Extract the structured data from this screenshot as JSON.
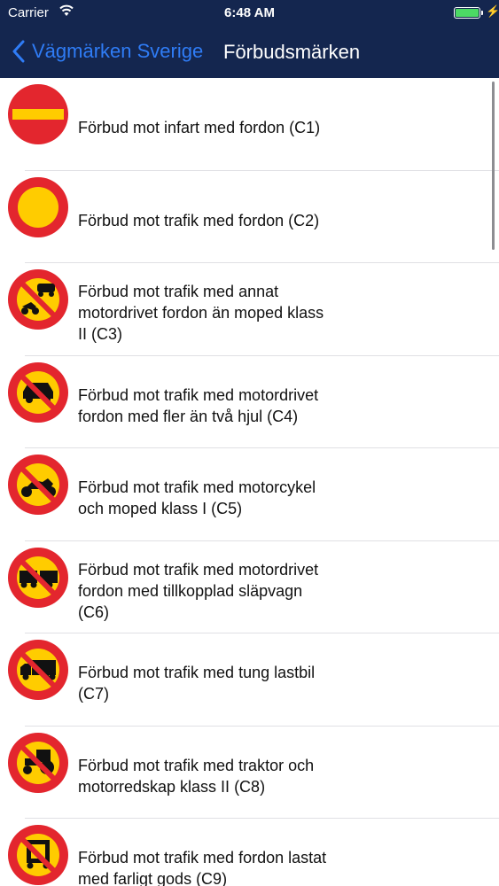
{
  "status_bar": {
    "carrier": "Carrier",
    "time": "6:48 AM"
  },
  "nav": {
    "back_label": "Vägmärken Sverige",
    "title": "Förbudsmärken"
  },
  "signs": [
    {
      "label": "Förbud mot infart med fordon (C1)",
      "icon": "no-entry-sign-icon"
    },
    {
      "label": "Förbud mot trafik med fordon (C2)",
      "icon": "no-vehicles-sign-icon"
    },
    {
      "label": "Förbud mot trafik med annat\nmotordrivet fordon än moped klass\nII (C3)",
      "icon": "no-motor-vehicles-sign-icon"
    },
    {
      "label": "Förbud mot trafik med motordrivet\nfordon med fler än två hjul (C4)",
      "icon": "no-cars-sign-icon"
    },
    {
      "label": "Förbud mot trafik med motorcykel\noch moped klass I (C5)",
      "icon": "no-motorcycles-sign-icon"
    },
    {
      "label": "Förbud mot trafik med motordrivet\nfordon med tillkopplad släpvagn\n(C6)",
      "icon": "no-trailers-sign-icon"
    },
    {
      "label": "Förbud mot trafik med tung lastbil\n(C7)",
      "icon": "no-heavy-trucks-sign-icon"
    },
    {
      "label": "Förbud mot trafik med traktor och\nmotorredskap klass II (C8)",
      "icon": "no-tractors-sign-icon"
    },
    {
      "label": "Förbud mot trafik med fordon lastat\nmed farligt gods (C9)",
      "icon": "no-dangerous-goods-sign-icon"
    }
  ],
  "colors": {
    "nav_background": "#14264f",
    "back_tint": "#2f7cf6",
    "sign_red": "#e3262e",
    "sign_yellow": "#ffcc00",
    "battery_green": "#4cd964"
  }
}
